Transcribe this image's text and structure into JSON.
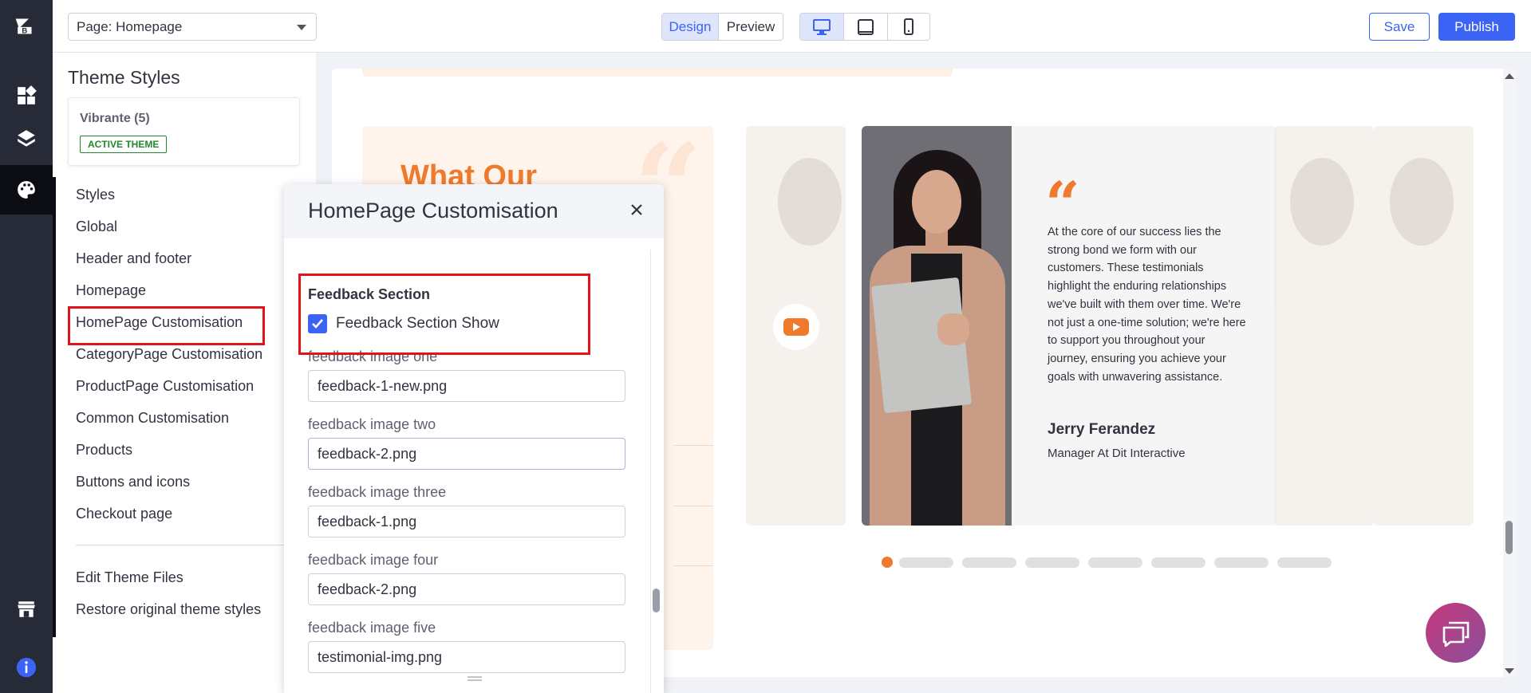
{
  "topbar": {
    "page_select": "Page: Homepage",
    "view_tabs": [
      "Design",
      "Preview"
    ],
    "save_label": "Save",
    "publish_label": "Publish"
  },
  "sidebar": {
    "title": "Theme Styles",
    "theme_name": "Vibrante (5)",
    "theme_badge": "ACTIVE THEME",
    "items": [
      "Styles",
      "Global",
      "Header and footer",
      "Homepage",
      "HomePage Customisation",
      "CategoryPage Customisation",
      "ProductPage Customisation",
      "Common Customisation",
      "Products",
      "Buttons and icons",
      "Checkout page"
    ],
    "footer_items": [
      "Edit Theme Files",
      "Restore original theme styles"
    ]
  },
  "modal": {
    "title": "HomePage Customisation",
    "section_title": "Feedback Section",
    "checkbox_label": "Feedback Section Show",
    "checkbox_checked": true,
    "fields": [
      {
        "label": "feedback image one",
        "value": "feedback-1-new.png"
      },
      {
        "label": "feedback image two",
        "value": "feedback-2.png"
      },
      {
        "label": "feedback image three",
        "value": "feedback-1.png"
      },
      {
        "label": "feedback image four",
        "value": "feedback-2.png"
      },
      {
        "label": "feedback image five",
        "value": "testimonial-img.png"
      }
    ]
  },
  "preview": {
    "heading": "What Our",
    "testimonial": "At the core of our success lies the strong bond we form with our customers. These testimonials highlight the enduring relationships we've built with them over time. We're not just a one-time solution; we're here to support you throughout your journey, ensuring you achieve your goals with unwavering assistance.",
    "person_name": "Jerry Ferandez",
    "person_role": "Manager At Dit Interactive",
    "carousel_dots": 8,
    "active_dot": 0
  },
  "colors": {
    "accent": "#3c64f4",
    "brand_orange": "#f07a2c",
    "highlight_red": "#e0141a",
    "rail_bg": "#272b37"
  }
}
